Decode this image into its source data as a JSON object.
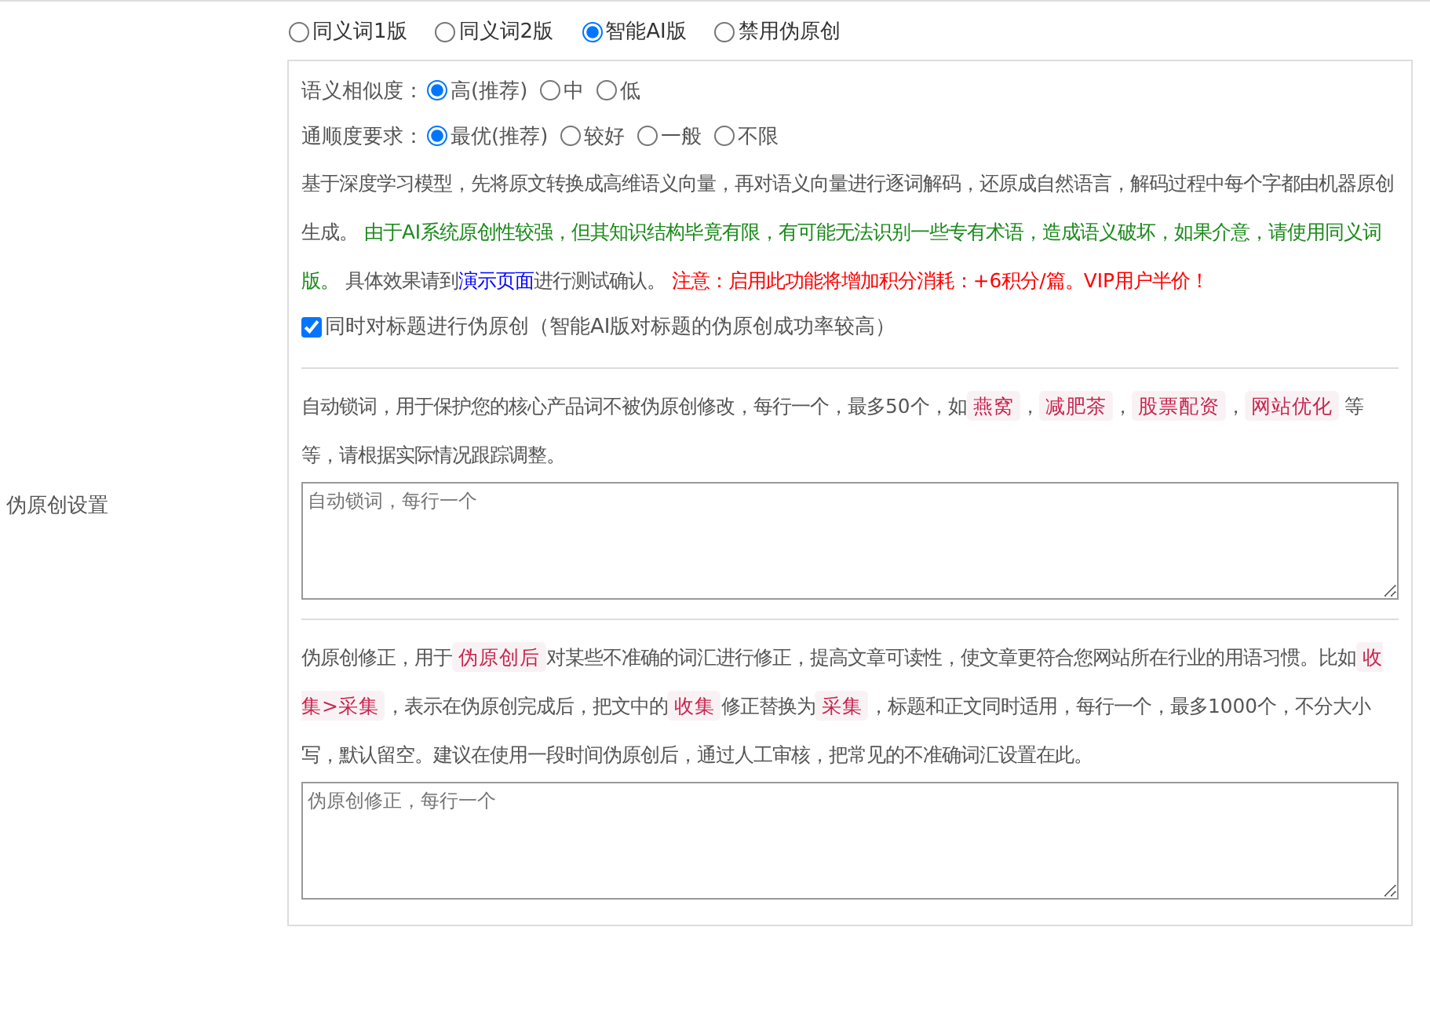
{
  "side_label": "伪原创设置",
  "modes": [
    {
      "label": "同义词1版",
      "selected": false
    },
    {
      "label": "同义词2版",
      "selected": false
    },
    {
      "label": "智能AI版",
      "selected": true
    },
    {
      "label": "禁用伪原创",
      "selected": false
    }
  ],
  "ai_settings": {
    "similarity": {
      "label": "语义相似度：",
      "options": [
        {
          "label": "高(推荐)",
          "selected": true
        },
        {
          "label": "中",
          "selected": false
        },
        {
          "label": "低",
          "selected": false
        }
      ]
    },
    "fluency": {
      "label": "通顺度要求：",
      "options": [
        {
          "label": "最优(推荐)",
          "selected": true
        },
        {
          "label": "较好",
          "selected": false
        },
        {
          "label": "一般",
          "selected": false
        },
        {
          "label": "不限",
          "selected": false
        }
      ]
    },
    "description": [
      {
        "kind": "plain",
        "text": "基于深度学习模型，先将原文转换成高维语义向量，再对语义向量进行逐词解码，还原成自然语言，解码过程中每个字都由机器原创生成。 "
      },
      {
        "kind": "green",
        "text": "由于AI系统原创性较强，但其知识结构毕竟有限，有可能无法识别一些专有术语，造成语义破坏，如果介意，请使用同义词版。"
      },
      {
        "kind": "plain",
        "text": " 具体效果请到"
      },
      {
        "kind": "link",
        "text": "演示页面"
      },
      {
        "kind": "plain",
        "text": "进行测试确认。 "
      },
      {
        "kind": "red",
        "text": "注意：启用此功能将增加积分消耗：+6积分/篇。VIP用户半价！"
      }
    ],
    "title_option": {
      "label": "同时对标题进行伪原创（智能AI版对标题的伪原创成功率较高）",
      "checked": true
    }
  },
  "lock_words": {
    "description": [
      {
        "kind": "plain",
        "text": "自动锁词，用于保护您的核心产品词不被伪原创修改，每行一个，最多50个，如"
      },
      {
        "kind": "code",
        "text": "燕窝"
      },
      {
        "kind": "plain",
        "text": "，"
      },
      {
        "kind": "code",
        "text": "减肥茶"
      },
      {
        "kind": "plain",
        "text": "，"
      },
      {
        "kind": "code",
        "text": "股票配资"
      },
      {
        "kind": "plain",
        "text": "，"
      },
      {
        "kind": "code",
        "text": "网站优化"
      },
      {
        "kind": "plain",
        "text": " 等等，请根据实际情况跟踪调整。"
      }
    ],
    "placeholder": "自动锁词，每行一个"
  },
  "corrections": {
    "description": [
      {
        "kind": "plain",
        "text": "伪原创修正，用于"
      },
      {
        "kind": "code",
        "text": "伪原创后"
      },
      {
        "kind": "plain",
        "text": "对某些不准确的词汇进行修正，提高文章可读性，使文章更符合您网站所在行业的用语习惯。比如"
      },
      {
        "kind": "code",
        "text": "收集>采集"
      },
      {
        "kind": "plain",
        "text": "，表示在伪原创完成后，把文中的"
      },
      {
        "kind": "code",
        "text": "收集"
      },
      {
        "kind": "plain",
        "text": "修正替换为"
      },
      {
        "kind": "code",
        "text": "采集"
      },
      {
        "kind": "plain",
        "text": "，标题和正文同时适用，每行一个，最多1000个，不分大小写，默认留空。建议在使用一段时间伪原创后，通过人工审核，把常见的不准确词汇设置在此。"
      }
    ],
    "placeholder": "伪原创修正，每行一个"
  }
}
